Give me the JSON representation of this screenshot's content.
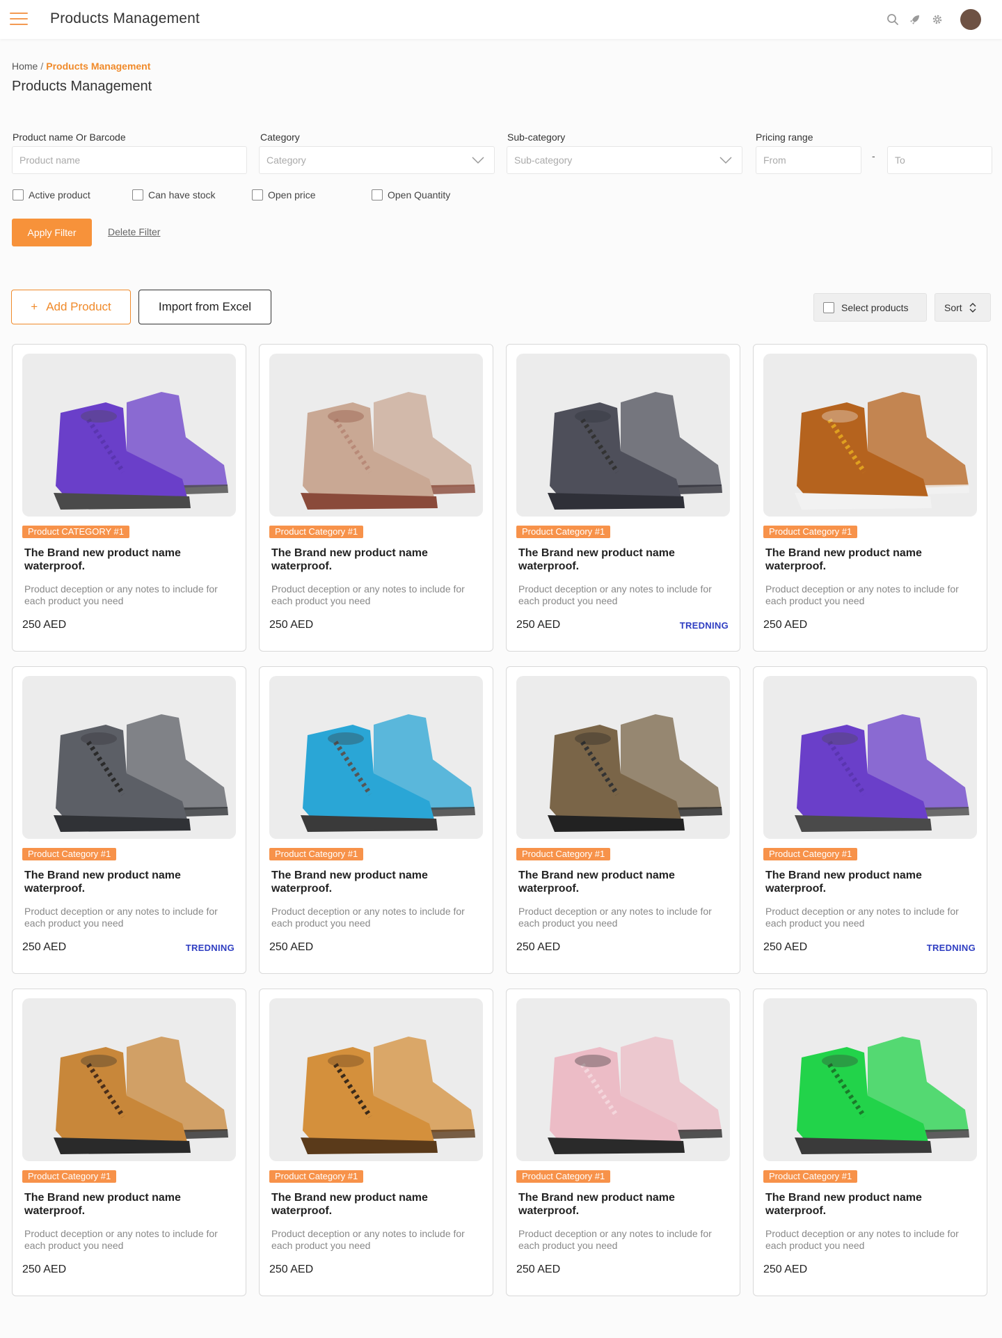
{
  "header": {
    "title": "Products Management",
    "icons": [
      "menu-icon",
      "search-icon",
      "rocket-icon",
      "settings-icon",
      "user-avatar"
    ]
  },
  "breadcrumb": {
    "home": "Home",
    "separator": "/",
    "current": "Products Management"
  },
  "page_title": "Products Management",
  "filters": {
    "product_name": {
      "label": "Product name Or Barcode",
      "placeholder": "Product name"
    },
    "category": {
      "label": "Category",
      "placeholder": "Category"
    },
    "sub_category": {
      "label": "Sub-category",
      "placeholder": "Sub-category"
    },
    "pricing": {
      "label": "Pricing range",
      "from_placeholder": "From",
      "separator": "-",
      "to_placeholder": "To"
    },
    "checkboxes": [
      {
        "label": "Active product",
        "checked": false
      },
      {
        "label": "Can have stock",
        "checked": false
      },
      {
        "label": "Open price",
        "checked": false
      },
      {
        "label": "Open Quantity",
        "checked": false
      }
    ],
    "apply_label": "Apply Filter",
    "delete_label": "Delete Filter"
  },
  "toolbar": {
    "add_plus": "+",
    "add_label": "Add Product",
    "import_label": "Import from Excel",
    "select_label": "Select products",
    "sort_label": "Sort"
  },
  "products": [
    {
      "category": "Product CATEGORY #1",
      "name": "The Brand new product name waterproof.",
      "description": "Product deception or any notes to include for each product you need",
      "price": "250 AED",
      "trend": "",
      "image": "purple-hiking-shoes"
    },
    {
      "category": "Product Category #1",
      "name": "The Brand new product name waterproof.",
      "description": "Product deception or any notes to include for each product you need",
      "price": "250 AED",
      "trend": "",
      "image": "beige-hiking-boots"
    },
    {
      "category": "Product Category #1",
      "name": "The Brand new product name waterproof.",
      "description": "Product deception or any notes to include for each product you need",
      "price": "250 AED",
      "trend": "TREDNING",
      "image": "grey-hiking-boots"
    },
    {
      "category": "Product Category #1",
      "name": "The Brand new product name waterproof.",
      "description": "Product deception or any notes to include for each product you need",
      "price": "250 AED",
      "trend": "",
      "image": "brown-leather-boots"
    },
    {
      "category": "Product Category #1",
      "name": "The Brand new product name waterproof.",
      "description": "Product deception or any notes to include for each product you need",
      "price": "250 AED",
      "trend": "TREDNING",
      "image": "dark-grey-hiking-boots"
    },
    {
      "category": "Product Category #1",
      "name": "The Brand new product name waterproof.",
      "description": "Product deception or any notes to include for each product you need",
      "price": "250 AED",
      "trend": "",
      "image": "blue-hiking-boots"
    },
    {
      "category": "Product Category #1",
      "name": "The Brand new product name waterproof.",
      "description": "Product deception or any notes to include for each product you need",
      "price": "250 AED",
      "trend": "",
      "image": "camo-hiking-boots"
    },
    {
      "category": "Product Category #1",
      "name": "The Brand new product name waterproof.",
      "description": "Product deception or any notes to include for each product you need",
      "price": "250 AED",
      "trend": "TREDNING",
      "image": "purple-hiking-shoes"
    },
    {
      "category": "Product Category #1",
      "name": "The Brand new product name waterproof.",
      "description": "Product deception or any notes to include for each product you need",
      "price": "250 AED",
      "trend": "",
      "image": "tan-ankle-boots"
    },
    {
      "category": "Product Category #1",
      "name": "The Brand new product name waterproof.",
      "description": "Product deception or any notes to include for each product you need",
      "price": "250 AED",
      "trend": "",
      "image": "tan-work-boots"
    },
    {
      "category": "Product Category #1",
      "name": "The Brand new product name waterproof.",
      "description": "Product deception or any notes to include for each product you need",
      "price": "250 AED",
      "trend": "",
      "image": "pink-boots"
    },
    {
      "category": "Product Category #1",
      "name": "The Brand new product name waterproof.",
      "description": "Product deception or any notes to include for each product you need",
      "price": "250 AED",
      "trend": "",
      "image": "green-hiking-boots"
    }
  ],
  "image_colors": {
    "purple-hiking-shoes": {
      "upper": "#6a3fc9",
      "sole": "#4a4a4a",
      "lace": "#5a35b0"
    },
    "beige-hiking-boots": {
      "upper": "#c9a894",
      "sole": "#8a4a3a",
      "lace": "#b88a78"
    },
    "grey-hiking-boots": {
      "upper": "#4e4f5a",
      "sole": "#2f3038",
      "lace": "#333"
    },
    "brown-leather-boots": {
      "upper": "#b5631e",
      "sole": "#f2f2f2",
      "lace": "#e0a020"
    },
    "dark-grey-hiking-boots": {
      "upper": "#5c5f66",
      "sole": "#303236",
      "lace": "#2a2a2a"
    },
    "blue-hiking-boots": {
      "upper": "#2aa6d6",
      "sole": "#3a3a3a",
      "lace": "#555"
    },
    "camo-hiking-boots": {
      "upper": "#7a6548",
      "sole": "#222",
      "lace": "#333"
    },
    "tan-ankle-boots": {
      "upper": "#c8873a",
      "sole": "#2a2a2a",
      "lace": "#4a2e1a"
    },
    "tan-work-boots": {
      "upper": "#d4903c",
      "sole": "#5a3a1a",
      "lace": "#3a2a1a"
    },
    "pink-boots": {
      "upper": "#ecbcc6",
      "sole": "#2a2a2a",
      "lace": "#f4d6dc"
    },
    "green-hiking-boots": {
      "upper": "#22d34a",
      "sole": "#3a3a3a",
      "lace": "#1a7a2a"
    }
  },
  "colors": {
    "accent": "#f7923a",
    "trend": "#2f3ec2"
  }
}
